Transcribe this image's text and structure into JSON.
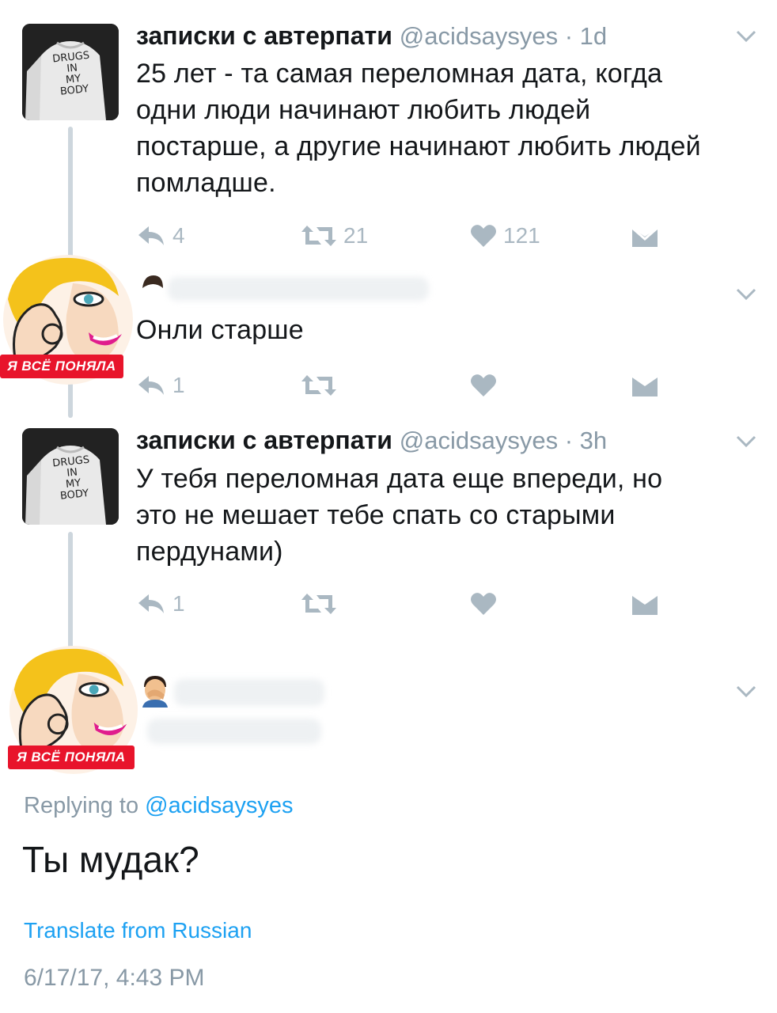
{
  "tweet1": {
    "name": "записки с автерпати",
    "handle": "@acidsaysyes",
    "time": "1d",
    "text_lines": [
      "25 лет - та самая переломная дата, когда",
      "одни люди начинают любить людей",
      "постарше, а другие начинают любить людей",
      "помладше."
    ],
    "replies": "4",
    "retweets": "21",
    "likes": "121",
    "avatar_shirt": [
      "DRUGS",
      "IN",
      "MY",
      "BODY"
    ]
  },
  "reply1": {
    "text": "Онли старше",
    "replies": "1",
    "badge": "Я ВСЁ ПОНЯЛА"
  },
  "tweet2": {
    "name": "записки с автерпати",
    "handle": "@acidsaysyes",
    "time": "3h",
    "text_lines": [
      "У тебя переломная дата еще впереди, но",
      "это не мешает тебе спать со старыми",
      "пердунами)"
    ],
    "replies": "1",
    "avatar_shirt": [
      "DRUGS",
      "IN",
      "MY",
      "BODY"
    ]
  },
  "focused": {
    "badge": "Я ВСЁ ПОНЯЛА",
    "replying_prefix": "Replying to ",
    "replying_handle": "@acidsaysyes",
    "text": "Ты мудак?",
    "translate": "Translate from Russian",
    "timestamp": "6/17/17, 4:43 PM"
  },
  "colors": {
    "text": "#14171a",
    "muted": "#8899a6",
    "icon": "#aab8c2",
    "link": "#1da1f2",
    "thread_line": "#cdd6dd",
    "badge": "#e8142b"
  }
}
